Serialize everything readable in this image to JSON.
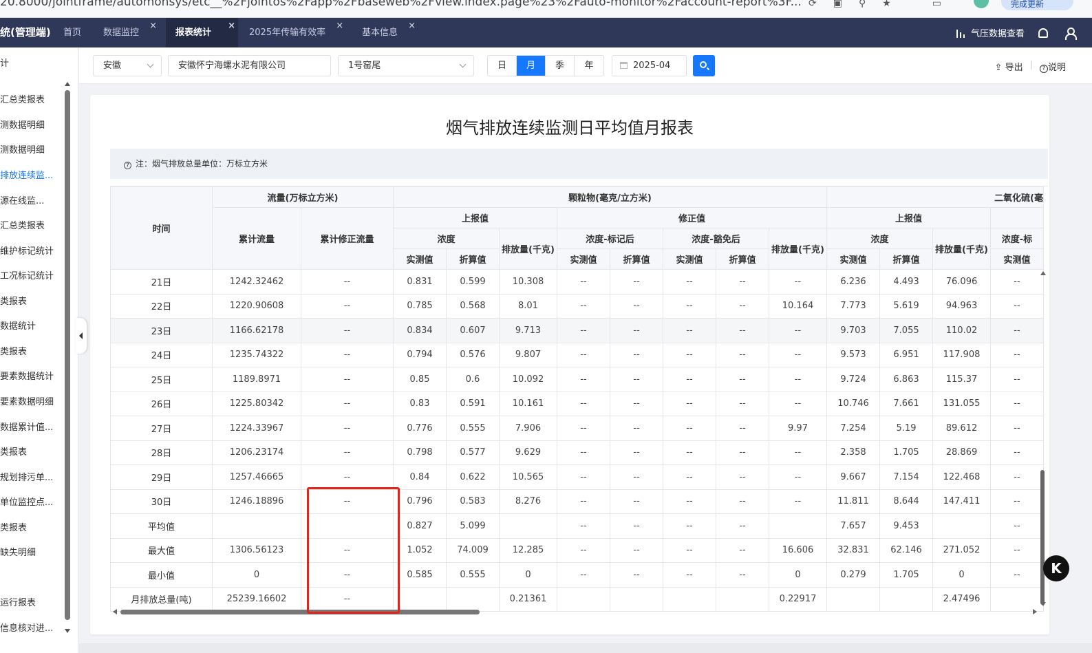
{
  "browser": {
    "url": "20.8000/jointframe/automonsys/etc__%2Fjointos%2Fapp%2Fbaseweb%2Fview.index.page%23%2Fauto-monitor%2Faccount-report%3F...",
    "update_label": "完成更新"
  },
  "topnav": {
    "app_title": "统(管理端)",
    "tabs": [
      {
        "label": "首页",
        "closable": false
      },
      {
        "label": "数据监控",
        "closable": true
      },
      {
        "label": "报表统计",
        "closable": true,
        "active": true
      },
      {
        "label": "2025年传输有效率",
        "closable": true
      },
      {
        "label": "基本信息",
        "closable": true
      }
    ],
    "close_glyph": "×",
    "pressure_label": "气压数据查看"
  },
  "sidebar": {
    "head": "计",
    "items": [
      {
        "label": "汇总类报表"
      },
      {
        "label": "测数据明细"
      },
      {
        "label": "测数据明细"
      },
      {
        "label": "排放连续监...",
        "active": true
      },
      {
        "label": "源在线监..."
      },
      {
        "label": "汇总类报表"
      },
      {
        "label": "维护标记统计"
      },
      {
        "label": "工况标记统计"
      },
      {
        "label": "类报表"
      },
      {
        "label": "数据统计"
      },
      {
        "label": "类报表"
      },
      {
        "label": "要素数据统计"
      },
      {
        "label": "要素数据明细"
      },
      {
        "label": "数据累计值..."
      },
      {
        "label": "类报表"
      },
      {
        "label": "规划排污单..."
      },
      {
        "label": "单位监控点..."
      },
      {
        "label": "类报表"
      },
      {
        "label": "缺失明细"
      },
      {
        "label": ""
      },
      {
        "label": "运行报表"
      },
      {
        "label": "信息核对进..."
      }
    ]
  },
  "filters": {
    "province": "安徽",
    "company": "安徽怀宁海螺水泥有限公司",
    "kiln": "1号窑尾",
    "periods": [
      "日",
      "月",
      "季",
      "年"
    ],
    "active_period": "月",
    "date": "2025-04",
    "export_label": "导出",
    "help_label": "说明",
    "export_glyph": "⇪",
    "help_glyph": "?"
  },
  "report": {
    "title": "烟气排放连续监测日平均值月报表",
    "note": "注：烟气排放总量单位：万标立方米",
    "headers": {
      "time": "时间",
      "flow": "流量(万标立方米)",
      "cum_flow": "累计流量",
      "cum_corr_flow": "累计修正流量",
      "pm": "颗粒物(毫克/立方米)",
      "reported": "上报值",
      "corrected": "修正值",
      "conc": "浓度",
      "emission": "排放量(千克)",
      "conc_marked": "浓度-标记后",
      "conc_exempt": "浓度-豁免后",
      "actual": "实测值",
      "converted": "折算值",
      "so2": "二氧化硫(毫",
      "so2_reported": "上报值",
      "so2_conc": "浓度",
      "so2_emission": "排放量(千克)",
      "so2_conc_marked": "浓度-标",
      "so2_actual": "实测值",
      "so2_converted": "折算值"
    },
    "rows": [
      [
        "21日",
        "1242.32462",
        "--",
        "0.831",
        "0.599",
        "10.308",
        "--",
        "--",
        "--",
        "--",
        "--",
        "6.236",
        "4.493",
        "76.096",
        "--"
      ],
      [
        "22日",
        "1220.90608",
        "--",
        "0.785",
        "0.568",
        "8.01",
        "--",
        "--",
        "--",
        "--",
        "10.164",
        "7.773",
        "5.619",
        "94.963",
        "--"
      ],
      [
        "23日",
        "1166.62178",
        "--",
        "0.834",
        "0.607",
        "9.713",
        "--",
        "--",
        "--",
        "--",
        "--",
        "9.703",
        "7.055",
        "110.02",
        "--"
      ],
      [
        "24日",
        "1235.74322",
        "--",
        "0.794",
        "0.576",
        "9.807",
        "--",
        "--",
        "--",
        "--",
        "--",
        "9.573",
        "6.951",
        "117.908",
        "--"
      ],
      [
        "25日",
        "1189.8971",
        "--",
        "0.85",
        "0.6",
        "10.092",
        "--",
        "--",
        "--",
        "--",
        "--",
        "9.724",
        "6.863",
        "115.37",
        "--"
      ],
      [
        "26日",
        "1225.80342",
        "--",
        "0.83",
        "0.591",
        "10.161",
        "--",
        "--",
        "--",
        "--",
        "--",
        "10.746",
        "7.661",
        "131.055",
        "--"
      ],
      [
        "27日",
        "1224.33967",
        "--",
        "0.776",
        "0.555",
        "7.906",
        "--",
        "--",
        "--",
        "--",
        "9.97",
        "7.254",
        "5.19",
        "89.612",
        "--"
      ],
      [
        "28日",
        "1206.23174",
        "--",
        "0.798",
        "0.577",
        "9.629",
        "--",
        "--",
        "--",
        "--",
        "--",
        "2.358",
        "1.705",
        "28.869",
        "--"
      ],
      [
        "29日",
        "1257.46665",
        "--",
        "0.84",
        "0.622",
        "10.565",
        "--",
        "--",
        "--",
        "--",
        "--",
        "9.667",
        "7.154",
        "122.468",
        "--"
      ],
      [
        "30日",
        "1246.18896",
        "--",
        "0.796",
        "0.583",
        "8.276",
        "--",
        "--",
        "--",
        "--",
        "--",
        "11.811",
        "8.644",
        "147.411",
        "--"
      ],
      [
        "平均值",
        "",
        "",
        "0.827",
        "5.099",
        "",
        "--",
        "--",
        "--",
        "--",
        "",
        "7.657",
        "9.453",
        "",
        "--"
      ],
      [
        "最大值",
        "1306.56123",
        "--",
        "1.052",
        "74.009",
        "12.285",
        "--",
        "--",
        "--",
        "--",
        "16.606",
        "32.831",
        "62.146",
        "271.052",
        "--"
      ],
      [
        "最小值",
        "0",
        "--",
        "0.585",
        "0.555",
        "0",
        "--",
        "--",
        "--",
        "--",
        "0",
        "0.279",
        "1.705",
        "0",
        "--"
      ],
      [
        "月排放总量(吨)",
        "25239.16602",
        "--",
        "",
        "",
        "0.21361",
        "",
        "",
        "",
        "",
        "0.22917",
        "",
        "",
        "2.47496",
        ""
      ]
    ]
  },
  "badge": {
    "label": "K"
  }
}
